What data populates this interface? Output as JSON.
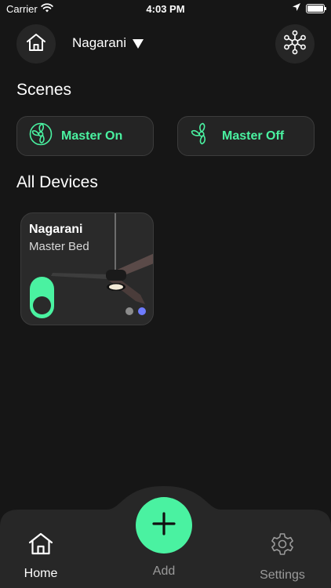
{
  "status_bar": {
    "carrier": "Carrier",
    "time": "4:03 PM",
    "icons": [
      "wifi-icon",
      "location-arrow-icon",
      "battery-icon"
    ]
  },
  "header": {
    "home_icon": "home-icon",
    "location": "Nagarani",
    "network_icon": "network-hub-icon"
  },
  "scenes": {
    "title": "Scenes",
    "items": [
      {
        "label": "Master On",
        "icon": "fan-icon"
      },
      {
        "label": "Master Off",
        "icon": "fan-off-icon"
      }
    ]
  },
  "devices": {
    "title": "All Devices",
    "items": [
      {
        "name": "Nagarani",
        "room": "Master Bed",
        "power": "on",
        "page_index": 1,
        "page_count": 2
      }
    ]
  },
  "bottom_nav": {
    "home_label": "Home",
    "add_label": "Add",
    "settings_label": "Settings",
    "active": "Home"
  },
  "colors": {
    "background": "#161616",
    "card": "#242424",
    "accent": "#4af2a1",
    "dot_active": "#6e7bff",
    "muted": "#9a9a9a"
  }
}
